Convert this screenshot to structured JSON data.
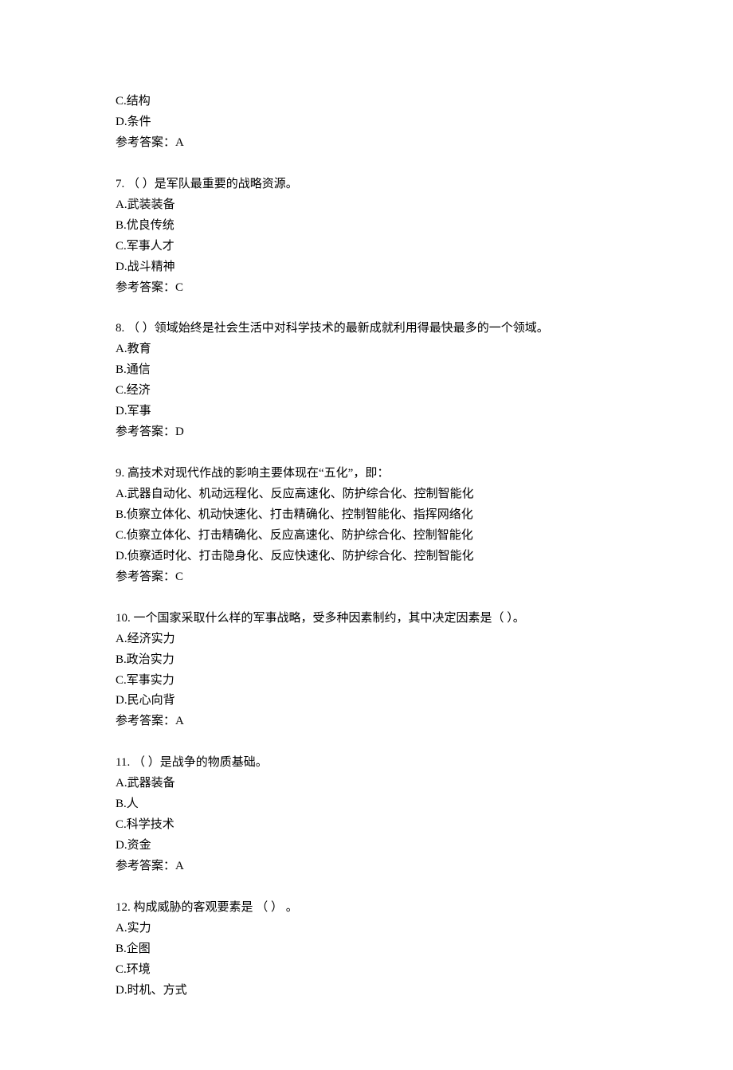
{
  "q6_trailing": {
    "options": [
      {
        "letter": "C",
        "text": "结构"
      },
      {
        "letter": "D",
        "text": "条件"
      }
    ],
    "answer_label": "参考答案：",
    "answer_value": "A"
  },
  "questions": [
    {
      "number": "7.",
      "stem": "（ ）是军队最重要的战略资源。",
      "options": [
        {
          "letter": "A",
          "text": "武装装备"
        },
        {
          "letter": "B",
          "text": "优良传统"
        },
        {
          "letter": "C",
          "text": "军事人才"
        },
        {
          "letter": "D",
          "text": "战斗精神"
        }
      ],
      "answer_label": "参考答案：",
      "answer_value": "C"
    },
    {
      "number": "8.",
      "stem": "（  ）领域始终是社会生活中对科学技术的最新成就利用得最快最多的一个领域。",
      "options": [
        {
          "letter": "A",
          "text": "教育"
        },
        {
          "letter": "B",
          "text": "通信"
        },
        {
          "letter": "C",
          "text": "经济"
        },
        {
          "letter": "D",
          "text": "军事"
        }
      ],
      "answer_label": "参考答案：",
      "answer_value": "D"
    },
    {
      "number": "9.",
      "stem": "高技术对现代作战的影响主要体现在“五化”，即：",
      "options": [
        {
          "letter": "A",
          "text": "武器自动化、机动远程化、反应高速化、防护综合化、控制智能化"
        },
        {
          "letter": "B",
          "text": "侦察立体化、机动快速化、打击精确化、控制智能化、指挥网络化"
        },
        {
          "letter": "C",
          "text": "侦察立体化、打击精确化、反应高速化、防护综合化、控制智能化"
        },
        {
          "letter": "D",
          "text": "侦察适时化、打击隐身化、反应快速化、防护综合化、控制智能化"
        }
      ],
      "answer_label": "参考答案：",
      "answer_value": "C"
    },
    {
      "number": "10.",
      "stem": "一个国家采取什么样的军事战略，受多种因素制约，其中决定因素是（   ）。",
      "options": [
        {
          "letter": "A",
          "text": "经济实力"
        },
        {
          "letter": "B",
          "text": "政治实力"
        },
        {
          "letter": "C",
          "text": "军事实力"
        },
        {
          "letter": "D",
          "text": "民心向背"
        }
      ],
      "answer_label": "参考答案：",
      "answer_value": "A"
    },
    {
      "number": "11.",
      "stem": "（   ）是战争的物质基础。",
      "options": [
        {
          "letter": "A",
          "text": "武器装备"
        },
        {
          "letter": "B",
          "text": "人"
        },
        {
          "letter": "C",
          "text": "科学技术"
        },
        {
          "letter": "D",
          "text": "资金"
        }
      ],
      "answer_label": "参考答案：",
      "answer_value": "A"
    },
    {
      "number": "12.",
      "stem": "构成威胁的客观要素是 （   ） 。",
      "options": [
        {
          "letter": "A",
          "text": "实力"
        },
        {
          "letter": "B",
          "text": "企图"
        },
        {
          "letter": "C",
          "text": "环境"
        },
        {
          "letter": "D",
          "text": "时机、方式"
        }
      ],
      "answer_label": "",
      "answer_value": ""
    }
  ]
}
